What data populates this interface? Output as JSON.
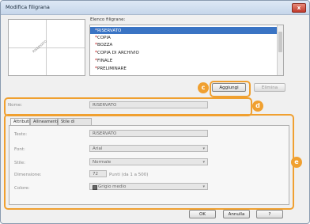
{
  "window": {
    "title": "Modifica filigrana",
    "close_label": "x"
  },
  "preview": {
    "watermark_text": "RISERVATO"
  },
  "list": {
    "label": "Elenco filigrane:",
    "items": [
      {
        "label": "RISERVATO",
        "selected": true
      },
      {
        "label": "COPIA",
        "selected": false
      },
      {
        "label": "BOZZA",
        "selected": false
      },
      {
        "label": "COPIA DI ARCHIVIO",
        "selected": false
      },
      {
        "label": "FINALE",
        "selected": false
      },
      {
        "label": "PRELIMINARE",
        "selected": false
      }
    ]
  },
  "buttons": {
    "add": "Aggiungi",
    "delete": "Elimina",
    "ok": "OK",
    "cancel": "Annulla",
    "help": "?"
  },
  "callouts": {
    "c": "c",
    "d": "d",
    "e": "e"
  },
  "name_row": {
    "label": "Nome:",
    "value": "RISERVATO"
  },
  "tabs": [
    {
      "label": "Attributi",
      "active": true
    },
    {
      "label": "Allineamento",
      "active": false
    },
    {
      "label": "Stile di stampa",
      "active": false
    }
  ],
  "attributes": {
    "text_label": "Testo:",
    "text_value": "RISERVATO",
    "font_label": "Font:",
    "font_value": "Arial",
    "style_label": "Stile:",
    "style_value": "Normale",
    "size_label": "Dimensione:",
    "size_value": "72",
    "size_unit": "Punti (da 1 a 500)",
    "color_label": "Colore:",
    "color_value": "Grigio medio"
  },
  "colors": {
    "accent": "#f0a030",
    "selection": "#3a74c4"
  }
}
